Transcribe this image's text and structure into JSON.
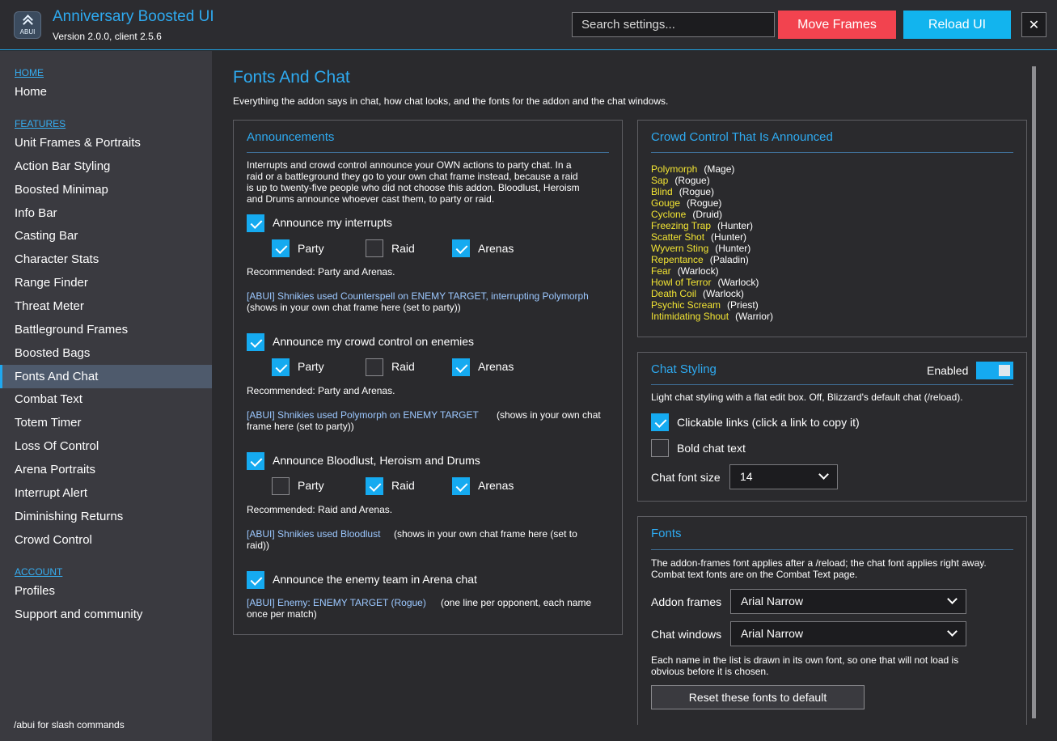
{
  "header": {
    "title": "Anniversary Boosted UI",
    "version": "Version 2.0.0, client 2.5.6",
    "logo_text": "ABUI",
    "search_placeholder": "Search settings...",
    "move_frames": "Move Frames",
    "reload_ui": "Reload UI",
    "close": "✕"
  },
  "sidebar": {
    "sections": [
      {
        "label": "HOME",
        "items": [
          "Home"
        ]
      },
      {
        "label": "FEATURES",
        "items": [
          "Unit Frames & Portraits",
          "Action Bar Styling",
          "Boosted Minimap",
          "Info Bar",
          "Casting Bar",
          "Character Stats",
          "Range Finder",
          "Threat Meter",
          "Battleground Frames",
          "Boosted Bags",
          "Fonts And Chat",
          "Combat Text",
          "Totem Timer",
          "Loss Of Control",
          "Arena Portraits",
          "Interrupt Alert",
          "Diminishing Returns",
          "Crowd Control"
        ]
      },
      {
        "label": "ACCOUNT",
        "items": [
          "Profiles",
          "Support and community"
        ]
      }
    ],
    "active": "Fonts And Chat",
    "footer": "/abui for slash commands"
  },
  "page": {
    "title": "Fonts And Chat",
    "description": "Everything the addon says in chat, how chat looks, and the fonts for the addon and the chat windows."
  },
  "announcements": {
    "title": "Announcements",
    "intro": [
      "Interrupts and crowd control announce your OWN actions to party chat.  In a",
      "raid or a battleground they go to your own chat frame instead, because a raid",
      "is up to twenty-five people who did not choose this addon.  Bloodlust, Heroism",
      "and Drums announce whoever cast them, to party or raid."
    ],
    "groups": [
      {
        "label": "Announce my interrupts",
        "checked": true,
        "options": [
          {
            "label": "Party",
            "checked": true
          },
          {
            "label": "Raid",
            "checked": false
          },
          {
            "label": "Arenas",
            "checked": true
          }
        ],
        "recommended": "Recommended: Party and Arenas.",
        "example_link": "[ABUI] Shnikies used Counterspell on ENEMY TARGET, interrupting Polymorph",
        "example_note": "(shows in your own chat frame here (set to party))"
      },
      {
        "label": "Announce my crowd control on enemies",
        "checked": true,
        "options": [
          {
            "label": "Party",
            "checked": true
          },
          {
            "label": "Raid",
            "checked": false
          },
          {
            "label": "Arenas",
            "checked": true
          }
        ],
        "recommended": "Recommended: Party and Arenas.",
        "example_link": "[ABUI] Shnikies used Polymorph on ENEMY TARGET",
        "example_note": "(shows in your own chat",
        "example_note2": "frame here (set to party))"
      },
      {
        "label": "Announce Bloodlust, Heroism and Drums",
        "checked": true,
        "options": [
          {
            "label": "Party",
            "checked": false
          },
          {
            "label": "Raid",
            "checked": true
          },
          {
            "label": "Arenas",
            "checked": true
          }
        ],
        "recommended": "Recommended: Raid and Arenas.",
        "example_link": "[ABUI] Shnikies used Bloodlust",
        "example_note": "(shows in your own chat frame here (set to",
        "example_note2": "raid))"
      },
      {
        "label": "Announce the enemy team in Arena chat",
        "checked": true,
        "example_link": "[ABUI] Enemy: ENEMY TARGET (Rogue)",
        "example_note": "(one line per opponent, each name",
        "example_note2": "once per match)"
      }
    ]
  },
  "crowd_control": {
    "title": "Crowd Control That Is Announced",
    "spells": [
      {
        "name": "Polymorph",
        "class": "(Mage)"
      },
      {
        "name": "Sap",
        "class": "(Rogue)"
      },
      {
        "name": "Blind",
        "class": "(Rogue)"
      },
      {
        "name": "Gouge",
        "class": "(Rogue)"
      },
      {
        "name": "Cyclone",
        "class": "(Druid)"
      },
      {
        "name": "Freezing Trap",
        "class": "(Hunter)"
      },
      {
        "name": "Scatter Shot",
        "class": "(Hunter)"
      },
      {
        "name": "Wyvern Sting",
        "class": "(Hunter)"
      },
      {
        "name": "Repentance",
        "class": "(Paladin)"
      },
      {
        "name": "Fear",
        "class": "(Warlock)"
      },
      {
        "name": "Howl of Terror",
        "class": "(Warlock)"
      },
      {
        "name": "Death Coil",
        "class": "(Warlock)"
      },
      {
        "name": "Psychic Scream",
        "class": "(Priest)"
      },
      {
        "name": "Intimidating Shout",
        "class": "(Warrior)"
      }
    ]
  },
  "chat_styling": {
    "title": "Chat Styling",
    "enabled_label": "Enabled",
    "enabled": true,
    "description": "Light chat styling with a flat edit box.  Off, Blizzard's default chat (/reload).",
    "clickable_links": {
      "label": "Clickable links (click a link to copy it)",
      "checked": true
    },
    "bold_text": {
      "label": "Bold chat text",
      "checked": false
    },
    "font_size_label": "Chat font size",
    "font_size": "14"
  },
  "fonts": {
    "title": "Fonts",
    "description": [
      "The addon-frames font applies after a /reload; the chat font applies right away.",
      "Combat text fonts are on the Combat Text page."
    ],
    "addon_frames_label": "Addon frames",
    "addon_frames_value": "Arial Narrow",
    "chat_windows_label": "Chat windows",
    "chat_windows_value": "Arial Narrow",
    "note": [
      "Each name in the list is drawn in its own font, so one that will not load is",
      "obvious before it is chosen."
    ],
    "reset_label": "Reset these fonts to default"
  },
  "colors": {
    "accent": "#2eaaf0",
    "check": "#15aaf0",
    "danger": "#f2434f",
    "cc_name": "#f2e433",
    "link": "#9cc8ff"
  }
}
